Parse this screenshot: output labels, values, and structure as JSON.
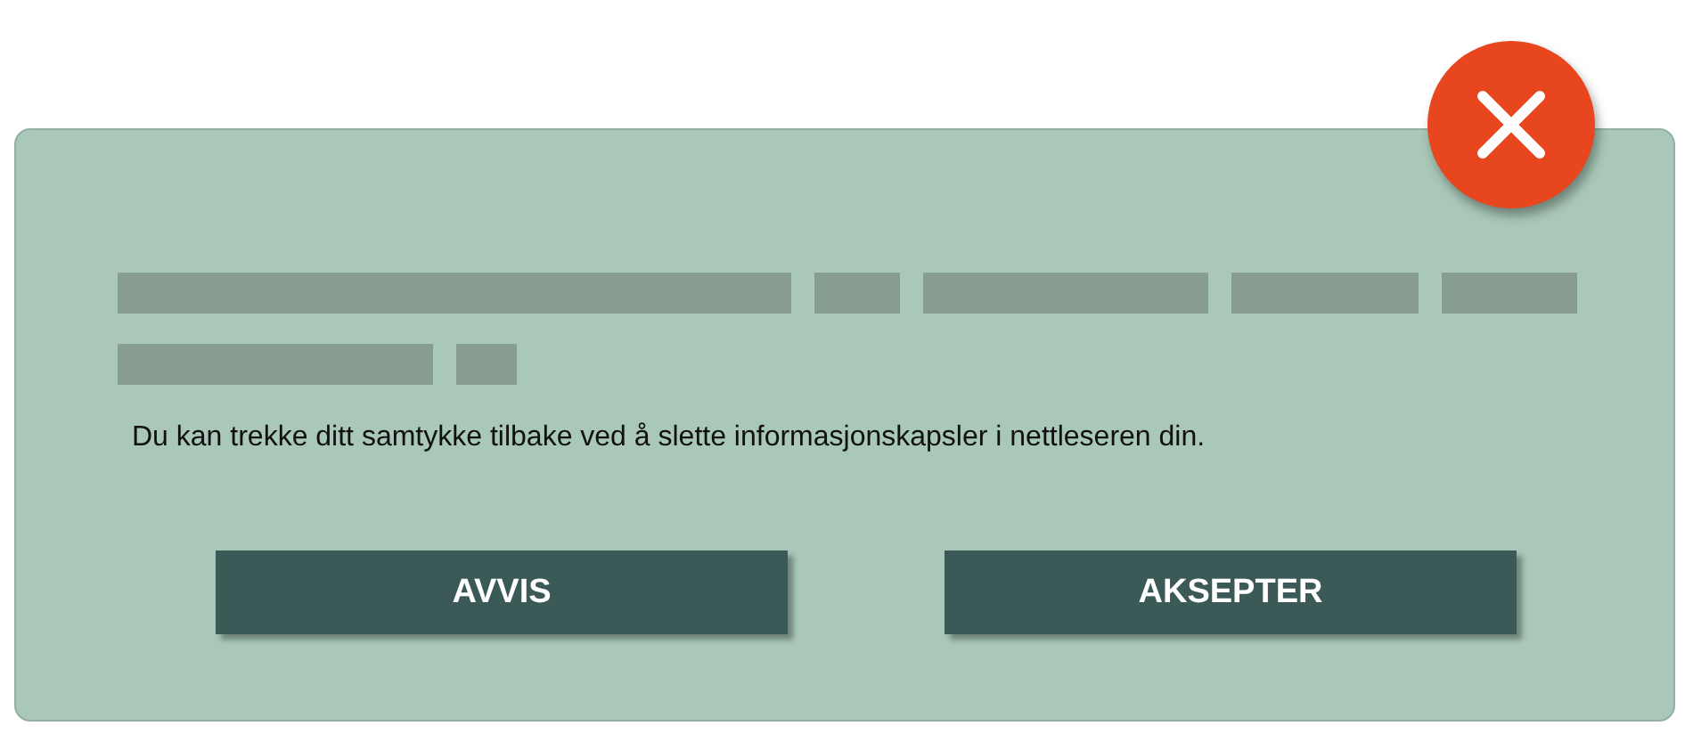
{
  "message": "Du kan trekke ditt samtykke tilbake ved å slette informasjonskapsler  i nettleseren din.",
  "buttons": [
    {
      "label": "AVVIS"
    },
    {
      "label": "AKSEPTER"
    }
  ]
}
